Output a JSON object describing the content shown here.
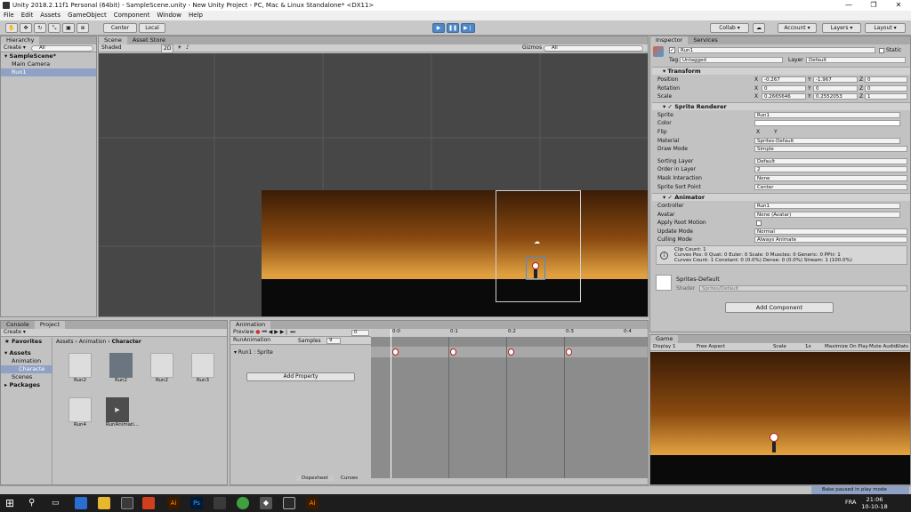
{
  "window": {
    "title": "Unity 2018.2.11f1 Personal (64bit) - SampleScene.unity - New Unity Project - PC, Mac & Linux Standalone* <DX11>",
    "min": "—",
    "max": "❐",
    "close": "✕"
  },
  "menu": [
    "File",
    "Edit",
    "Assets",
    "GameObject",
    "Component",
    "Window",
    "Help"
  ],
  "toolbar": {
    "center": "Center",
    "local": "Local",
    "collab": "Collab",
    "account": "Account",
    "layers": "Layers",
    "layout": "Layout",
    "cloud": "☁"
  },
  "hierarchy": {
    "tab": "Hierarchy",
    "create": "Create",
    "search": "All",
    "scene": "SampleScene*",
    "items": [
      "Main Camera",
      "Run1"
    ]
  },
  "scene": {
    "tabs": [
      "Scene",
      "Asset Store"
    ],
    "shaded": "Shaded",
    "mode2d": "2D",
    "gizmos": "Gizmos",
    "search": "All"
  },
  "inspector": {
    "tabs": [
      "Inspector",
      "Services"
    ],
    "name": "Run1",
    "static": "Static",
    "tag_label": "Tag",
    "tag": "Untagged",
    "layer_label": "Layer",
    "layer": "Default",
    "transform": {
      "title": "Transform",
      "position": "Position",
      "rotation": "Rotation",
      "scale": "Scale",
      "px": "-0.267",
      "py": "-1.967",
      "pz": "0",
      "rx": "0",
      "ry": "0",
      "rz": "0",
      "sx": "0.2665646",
      "sy": "0.2552053",
      "sz": "1"
    },
    "sprite_renderer": {
      "title": "Sprite Renderer",
      "sprite_l": "Sprite",
      "sprite": "Run1",
      "color_l": "Color",
      "flip_l": "Flip",
      "flip_x": "X",
      "flip_y": "Y",
      "material_l": "Material",
      "material": "Sprites-Default",
      "draw_l": "Draw Mode",
      "draw": "Simple",
      "sort_layer_l": "Sorting Layer",
      "sort_layer": "Default",
      "order_l": "Order in Layer",
      "order": "2",
      "mask_l": "Mask Interaction",
      "mask": "None",
      "sort_point_l": "Sprite Sort Point",
      "sort_point": "Center"
    },
    "animator": {
      "title": "Animator",
      "controller_l": "Controller",
      "controller": "Run1",
      "avatar_l": "Avatar",
      "avatar": "None (Avatar)",
      "root_l": "Apply Root Motion",
      "update_l": "Update Mode",
      "update": "Normal",
      "culling_l": "Culling Mode",
      "culling": "Always Animate",
      "info": [
        "Clip Count: 1",
        "Curves Pos: 0 Quat: 0 Euler: 0 Scale: 0 Muscles: 0 Generic: 0 PPtr: 1",
        "Curves Count: 1 Constant: 0 (0.0%) Dense: 0 (0.0%) Stream: 1 (100.0%)"
      ]
    },
    "material_block": {
      "name": "Sprites-Default",
      "shader_l": "Shader",
      "shader": "Sprites/Default"
    },
    "add_component": "Add Component"
  },
  "project": {
    "tabs": [
      "Console",
      "Project"
    ],
    "create": "Create",
    "favorites": "Favorites",
    "assets": "Assets",
    "animation": "Animation",
    "character": "Characte",
    "scenes": "Scenes",
    "packages": "Packages",
    "breadcrumb": [
      "Assets",
      "Animation",
      "Character"
    ],
    "files": [
      "Run2",
      "Run2",
      "Run2",
      "Run3",
      "Run4",
      "RunAnimati..."
    ]
  },
  "animation": {
    "tab": "Animation",
    "preview": "Preview",
    "clip": "RunAnimation",
    "samples_l": "Samples",
    "samples": "9",
    "frame": "0",
    "track": "Run1 : Sprite",
    "add_property": "Add Property",
    "times": [
      "0:0",
      "0:1",
      "0:2",
      "0:3",
      "0:4"
    ],
    "dopesheet": "Dopesheet",
    "curves": "Curves"
  },
  "game": {
    "tab": "Game",
    "display": "Display 1",
    "aspect": "Free Aspect",
    "scale_l": "Scale",
    "scale": "1x",
    "maximize": "Maximize On Play",
    "mute": "Mute Audio",
    "stats": "Stats"
  },
  "status": "Bake paused in play mode",
  "taskbar": {
    "lang": "FRA",
    "time": "21:06",
    "date": "10-10-18"
  }
}
